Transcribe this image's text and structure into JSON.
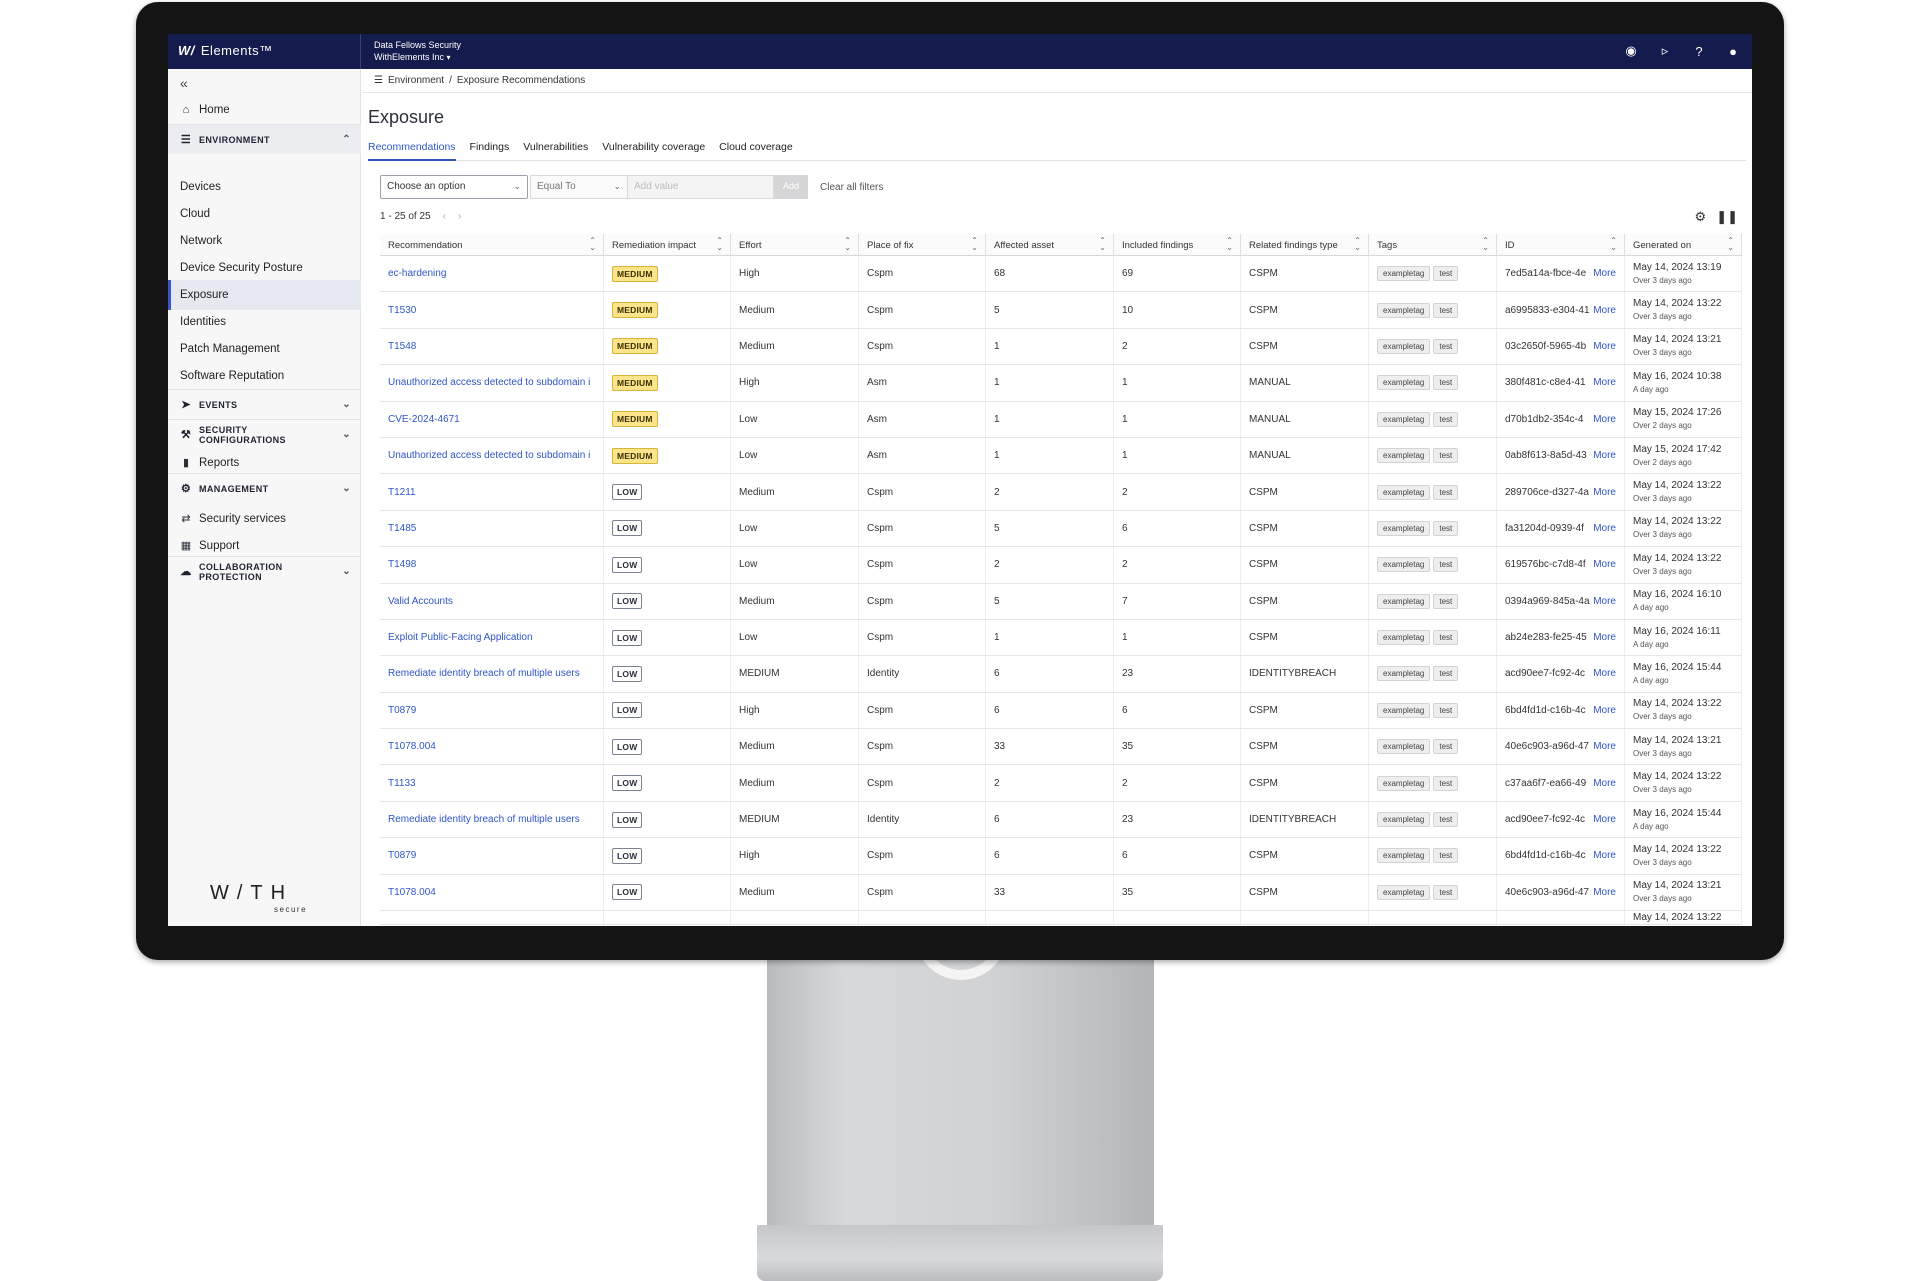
{
  "topbar": {
    "brand_mark": "W/",
    "brand_name": "Elements™",
    "org_name": "Data Fellows Security",
    "org_tenant": "WithElements Inc",
    "icons": [
      "robot-icon",
      "megaphone-icon",
      "help-icon",
      "user-icon"
    ]
  },
  "sidebar": {
    "collapse_glyph": "«",
    "home": "Home",
    "environment": "ENVIRONMENT",
    "env_items": [
      "Devices",
      "Cloud",
      "Network",
      "Device Security Posture",
      "Exposure",
      "Identities",
      "Patch Management",
      "Software Reputation"
    ],
    "active_item": "Exposure",
    "events": "EVENTS",
    "security_configurations_1": "SECURITY",
    "security_configurations_2": "CONFIGURATIONS",
    "reports": "Reports",
    "management": "MANAGEMENT",
    "security_services": "Security services",
    "support": "Support",
    "collab_1": "COLLABORATION",
    "collab_2": "PROTECTION",
    "logo": "W/TH",
    "logo_sub": "secure"
  },
  "breadcrumb": {
    "root": "Environment",
    "sep": "/",
    "current": "Exposure Recommendations"
  },
  "page": {
    "title": "Exposure",
    "tabs": [
      "Recommendations",
      "Findings",
      "Vulnerabilities",
      "Vulnerability coverage",
      "Cloud coverage"
    ],
    "active_tab": "Recommendations"
  },
  "filters": {
    "field_value": "Choose an option",
    "operator_value": "Equal To",
    "value_placeholder": "Add value",
    "add_label": "Add",
    "clear_label": "Clear all filters"
  },
  "pager": {
    "range": "1 - 25 of 25",
    "prev": "‹",
    "next": "›"
  },
  "table": {
    "columns": [
      "Recommendation",
      "Remediation impact",
      "Effort",
      "Place of fix",
      "Affected asset",
      "Included findings",
      "Related findings type",
      "Tags",
      "ID",
      "Generated on"
    ],
    "tags": [
      "exampletag",
      "test"
    ],
    "more_label": "More",
    "rows": [
      {
        "rec": "ec-hardening",
        "impact": "MEDIUM",
        "effort": "High",
        "place": "Cspm",
        "assets": "68",
        "findings": "69",
        "type": "CSPM",
        "id": "7ed5a14a-fbce-4e",
        "date": "May 14, 2024 13:19",
        "ago": "Over 3 days ago"
      },
      {
        "rec": "T1530",
        "impact": "MEDIUM",
        "effort": "Medium",
        "place": "Cspm",
        "assets": "5",
        "findings": "10",
        "type": "CSPM",
        "id": "a6995833-e304-41",
        "date": "May 14, 2024 13:22",
        "ago": "Over 3 days ago"
      },
      {
        "rec": "T1548",
        "impact": "MEDIUM",
        "effort": "Medium",
        "place": "Cspm",
        "assets": "1",
        "findings": "2",
        "type": "CSPM",
        "id": "03c2650f-5965-4b",
        "date": "May 14, 2024 13:21",
        "ago": "Over 3 days ago"
      },
      {
        "rec": "Unauthorized access detected to subdomain i",
        "impact": "MEDIUM",
        "effort": "High",
        "place": "Asm",
        "assets": "1",
        "findings": "1",
        "type": "MANUAL",
        "id": "380f481c-c8e4-41",
        "date": "May 16, 2024 10:38",
        "ago": "A day ago"
      },
      {
        "rec": "CVE-2024-4671",
        "impact": "MEDIUM",
        "effort": "Low",
        "place": "Asm",
        "assets": "1",
        "findings": "1",
        "type": "MANUAL",
        "id": "d70b1db2-354c-4",
        "date": "May 15, 2024 17:26",
        "ago": "Over 2 days ago"
      },
      {
        "rec": "Unauthorized access detected to subdomain i",
        "impact": "MEDIUM",
        "effort": "Low",
        "place": "Asm",
        "assets": "1",
        "findings": "1",
        "type": "MANUAL",
        "id": "0ab8f613-8a5d-43",
        "date": "May 15, 2024 17:42",
        "ago": "Over 2 days ago"
      },
      {
        "rec": "T1211",
        "impact": "LOW",
        "effort": "Medium",
        "place": "Cspm",
        "assets": "2",
        "findings": "2",
        "type": "CSPM",
        "id": "289706ce-d327-4a",
        "date": "May 14, 2024 13:22",
        "ago": "Over 3 days ago"
      },
      {
        "rec": "T1485",
        "impact": "LOW",
        "effort": "Low",
        "place": "Cspm",
        "assets": "5",
        "findings": "6",
        "type": "CSPM",
        "id": "fa31204d-0939-4f",
        "date": "May 14, 2024 13:22",
        "ago": "Over 3 days ago"
      },
      {
        "rec": "T1498",
        "impact": "LOW",
        "effort": "Low",
        "place": "Cspm",
        "assets": "2",
        "findings": "2",
        "type": "CSPM",
        "id": "619576bc-c7d8-4f",
        "date": "May 14, 2024 13:22",
        "ago": "Over 3 days ago"
      },
      {
        "rec": "Valid Accounts",
        "impact": "LOW",
        "effort": "Medium",
        "place": "Cspm",
        "assets": "5",
        "findings": "7",
        "type": "CSPM",
        "id": "0394a969-845a-4a",
        "date": "May 16, 2024 16:10",
        "ago": "A day ago"
      },
      {
        "rec": "Exploit Public-Facing Application",
        "impact": "LOW",
        "effort": "Low",
        "place": "Cspm",
        "assets": "1",
        "findings": "1",
        "type": "CSPM",
        "id": "ab24e283-fe25-45",
        "date": "May 16, 2024 16:11",
        "ago": "A day ago"
      },
      {
        "rec": "Remediate identity breach of multiple users",
        "impact": "LOW",
        "effort": "MEDIUM",
        "place": "Identity",
        "assets": "6",
        "findings": "23",
        "type": "IDENTITYBREACH",
        "id": "acd90ee7-fc92-4c",
        "date": "May 16, 2024 15:44",
        "ago": "A day ago"
      },
      {
        "rec": "T0879",
        "impact": "LOW",
        "effort": "High",
        "place": "Cspm",
        "assets": "6",
        "findings": "6",
        "type": "CSPM",
        "id": "6bd4fd1d-c16b-4c",
        "date": "May 14, 2024 13:22",
        "ago": "Over 3 days ago"
      },
      {
        "rec": "T1078.004",
        "impact": "LOW",
        "effort": "Medium",
        "place": "Cspm",
        "assets": "33",
        "findings": "35",
        "type": "CSPM",
        "id": "40e6c903-a96d-47",
        "date": "May 14, 2024 13:21",
        "ago": "Over 3 days ago"
      },
      {
        "rec": "T1133",
        "impact": "LOW",
        "effort": "Medium",
        "place": "Cspm",
        "assets": "2",
        "findings": "2",
        "type": "CSPM",
        "id": "c37aa6f7-ea66-49",
        "date": "May 14, 2024 13:22",
        "ago": "Over 3 days ago"
      },
      {
        "rec": "Remediate identity breach of multiple users",
        "impact": "LOW",
        "effort": "MEDIUM",
        "place": "Identity",
        "assets": "6",
        "findings": "23",
        "type": "IDENTITYBREACH",
        "id": "acd90ee7-fc92-4c",
        "date": "May 16, 2024 15:44",
        "ago": "A day ago"
      },
      {
        "rec": "T0879",
        "impact": "LOW",
        "effort": "High",
        "place": "Cspm",
        "assets": "6",
        "findings": "6",
        "type": "CSPM",
        "id": "6bd4fd1d-c16b-4c",
        "date": "May 14, 2024 13:22",
        "ago": "Over 3 days ago"
      },
      {
        "rec": "T1078.004",
        "impact": "LOW",
        "effort": "Medium",
        "place": "Cspm",
        "assets": "33",
        "findings": "35",
        "type": "CSPM",
        "id": "40e6c903-a96d-47",
        "date": "May 14, 2024 13:21",
        "ago": "Over 3 days ago"
      }
    ],
    "partial_row_date": "May 14, 2024 13:22"
  },
  "colors": {
    "topbar": "#141b4d",
    "link": "#2f55c9",
    "medium_badge": "#fbe489"
  }
}
